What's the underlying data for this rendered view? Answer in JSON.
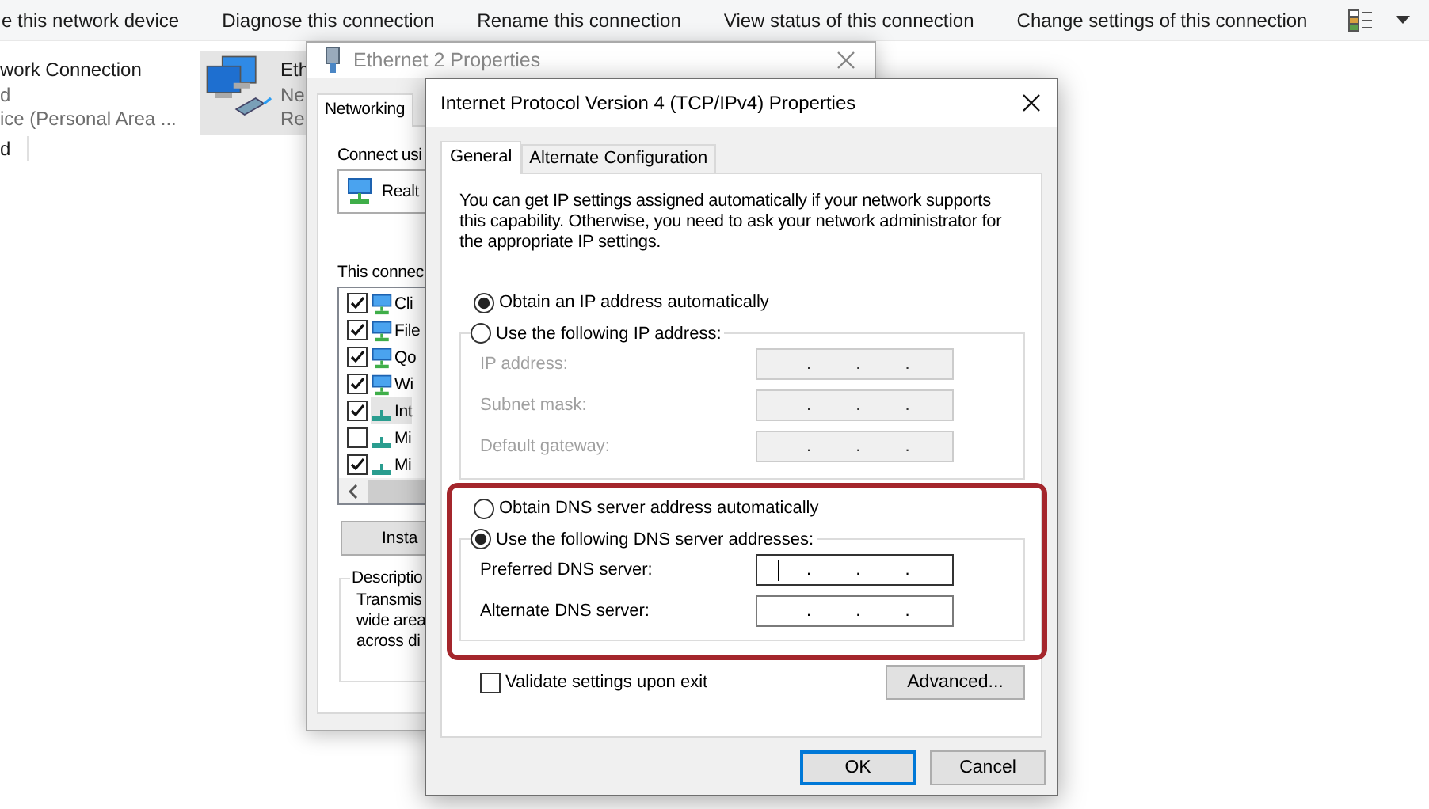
{
  "explorer": {
    "toolbar": [
      {
        "label": "e this network device"
      },
      {
        "label": "Diagnose this connection"
      },
      {
        "label": "Rename this connection"
      },
      {
        "label": "View status of this connection"
      },
      {
        "label": "Change settings of this connection"
      }
    ],
    "connections": [
      {
        "name": "work Connection",
        "status": "d",
        "device": "ice (Personal Area ...",
        "selected": false,
        "icon_visible": false
      },
      {
        "name": "Eth",
        "status": "Ne",
        "device": "Re",
        "selected": true,
        "icon_visible": true
      }
    ],
    "status_text": "d"
  },
  "ethernet_window": {
    "title": "Ethernet 2 Properties",
    "tabs": [
      {
        "label": "Networking",
        "selected": true
      }
    ],
    "connect_using_label": "Connect usi",
    "adapter": "Realt",
    "components_label": "This connec",
    "components": [
      {
        "label": "Cli",
        "checked": true,
        "kind": "service",
        "selected": false
      },
      {
        "label": "File",
        "checked": true,
        "kind": "service",
        "selected": false
      },
      {
        "label": "Qo",
        "checked": true,
        "kind": "service",
        "selected": false
      },
      {
        "label": "Wi",
        "checked": true,
        "kind": "service",
        "selected": false
      },
      {
        "label": "Int",
        "checked": true,
        "kind": "protocol",
        "selected": true
      },
      {
        "label": "Mi",
        "checked": false,
        "kind": "protocol",
        "selected": false
      },
      {
        "label": "Mi",
        "checked": true,
        "kind": "protocol",
        "selected": false
      }
    ],
    "install_button": "Insta",
    "description_title": "Descriptio",
    "description_lines": [
      "Transmis",
      "wide area",
      "across di"
    ]
  },
  "ipv4_window": {
    "title": "Internet Protocol Version 4 (TCP/IPv4) Properties",
    "tabs": [
      {
        "label": "General",
        "selected": true
      },
      {
        "label": "Alternate Configuration",
        "selected": false
      }
    ],
    "intro": "You can get IP settings assigned automatically if your network supports this capability. Otherwise, you need to ask your network administrator for the appropriate IP settings.",
    "ip_options": [
      {
        "label": "Obtain an IP address automatically",
        "selected": true
      },
      {
        "label": "Use the following IP address:",
        "selected": false
      }
    ],
    "ip_fields": [
      {
        "label": "IP address:",
        "value": ". . .",
        "disabled": true,
        "focused": false
      },
      {
        "label": "Subnet mask:",
        "value": ". . .",
        "disabled": true,
        "focused": false
      },
      {
        "label": "Default gateway:",
        "value": ". . .",
        "disabled": true,
        "focused": false
      }
    ],
    "dns_highlighted": true,
    "dns_options": [
      {
        "label": "Obtain DNS server address automatically",
        "selected": false
      },
      {
        "label": "Use the following DNS server addresses:",
        "selected": true
      }
    ],
    "dns_fields": [
      {
        "label": "Preferred DNS server:",
        "value": ". . .",
        "disabled": false,
        "focused": true
      },
      {
        "label": "Alternate DNS server:",
        "value": ". . .",
        "disabled": false,
        "focused": false
      }
    ],
    "validate": {
      "label": "Validate settings upon exit",
      "checked": false
    },
    "advanced_button": "Advanced...",
    "buttons": [
      {
        "label": "OK",
        "default": true
      },
      {
        "label": "Cancel",
        "default": false
      }
    ]
  }
}
